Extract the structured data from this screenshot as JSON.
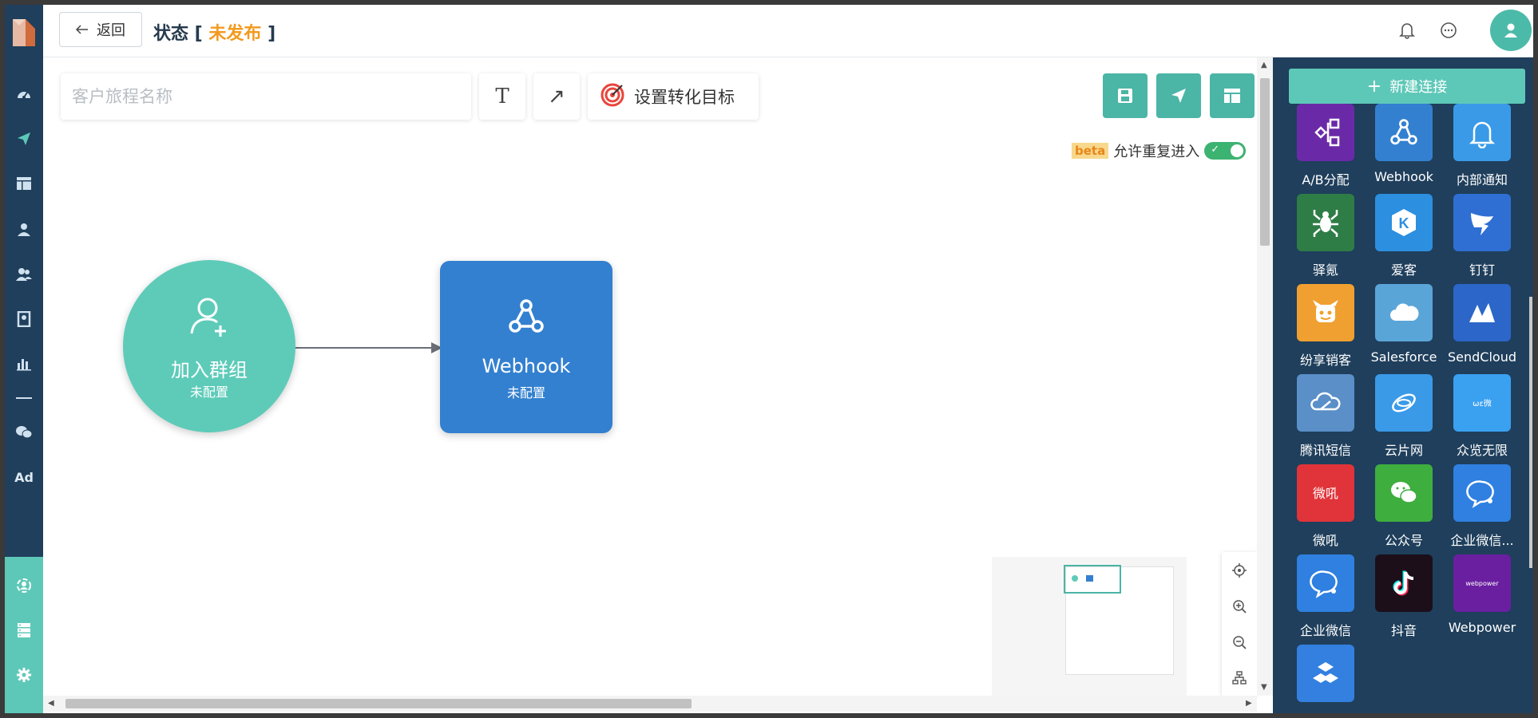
{
  "header": {
    "back_label": "返回",
    "status_prefix": "状态 [",
    "status_value": "未发布",
    "status_suffix": "]",
    "icons": [
      "bell-icon",
      "chat-icon",
      "user-icon"
    ]
  },
  "leftnav": {
    "icons": [
      "dashboard-icon",
      "send-icon",
      "table-icon",
      "user-icon",
      "users-icon",
      "bookmark-icon",
      "chart-icon",
      "wechat-icon"
    ],
    "ad_label": "Ad",
    "bottom_icons": [
      "hub-icon",
      "database-icon",
      "gear-icon"
    ]
  },
  "toolbar": {
    "name_placeholder": "客户旅程名称",
    "text_tool_label": "T",
    "arrow_tool_label": "↗",
    "goal_label": "设置转化目标",
    "action_icons": [
      "save-icon",
      "publish-icon",
      "layout-icon"
    ],
    "beta_label": "beta",
    "reentry_label": "允许重复进入",
    "reentry_enabled": true
  },
  "canvas": {
    "nodes": [
      {
        "title": "加入群组",
        "subtitle": "未配置",
        "shape": "circle",
        "color": "#5ecbb9",
        "icon": "add-user-icon"
      },
      {
        "title": "Webhook",
        "subtitle": "未配置",
        "shape": "square",
        "color": "#3380d0",
        "icon": "webhook-icon"
      }
    ]
  },
  "panel": {
    "new_connection_label": "新建连接",
    "connectors": [
      {
        "label": "A/B分配",
        "color": "#6a2aa8",
        "icon": "ab-split-icon"
      },
      {
        "label": "Webhook",
        "color": "#3380d0",
        "icon": "webhook-icon"
      },
      {
        "label": "内部通知",
        "color": "#3a9ae8",
        "icon": "bell-icon"
      },
      {
        "label": "驿氪",
        "color": "#2f7d46",
        "icon": "spider-icon"
      },
      {
        "label": "爱客",
        "color": "#2c8fe0",
        "icon": "k-hex-icon"
      },
      {
        "label": "钉钉",
        "color": "#2f6fd3",
        "icon": "dingtalk-icon"
      },
      {
        "label": "纷享销客",
        "color": "#f0a030",
        "icon": "mascot-icon"
      },
      {
        "label": "Salesforce",
        "color": "#5aa5d8",
        "icon": "cloud-icon"
      },
      {
        "label": "SendCloud",
        "color": "#2b66c8",
        "icon": "sendcloud-icon"
      },
      {
        "label": "腾讯短信",
        "color": "#5a8fc8",
        "icon": "tencent-cloud-icon"
      },
      {
        "label": "云片网",
        "color": "#3a9ae8",
        "icon": "yunpian-icon"
      },
      {
        "label": "众览无限",
        "color": "#3aa0f0",
        "icon": "zhonglan-icon"
      },
      {
        "label": "微吼",
        "color": "#e0343a",
        "icon": "vhall-icon"
      },
      {
        "label": "公众号",
        "color": "#3eae3e",
        "icon": "wechat-icon"
      },
      {
        "label": "企业微信...",
        "color": "#2f80e0",
        "icon": "wecom-icon"
      },
      {
        "label": "企业微信",
        "color": "#2f80e0",
        "icon": "wecom-icon"
      },
      {
        "label": "抖音",
        "color": "#1c0f1a",
        "icon": "tiktok-icon"
      },
      {
        "label": "Webpower",
        "color": "#6a1fa0",
        "icon": "webpower-icon"
      },
      {
        "label": "",
        "color": "#3380e0",
        "icon": "cube-icon"
      }
    ]
  }
}
